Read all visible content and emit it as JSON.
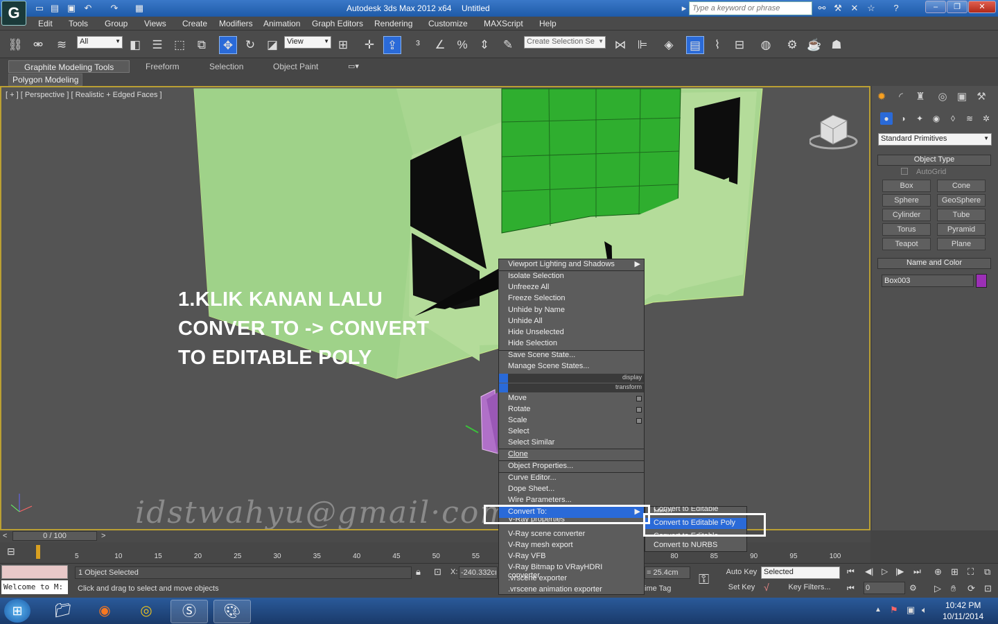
{
  "title": {
    "app": "Autodesk 3ds Max  2012 x64",
    "doc": "Untitled",
    "search_placeholder": "Type a keyword or phrase"
  },
  "menu": [
    "Edit",
    "Tools",
    "Group",
    "Views",
    "Create",
    "Modifiers",
    "Animation",
    "Graph Editors",
    "Rendering",
    "Customize",
    "MAXScript",
    "Help"
  ],
  "toolbar": {
    "filter_value": "All",
    "refcoord_value": "View",
    "selset_placeholder": "Create Selection Se"
  },
  "ribbon": {
    "tabs": [
      "Graphite Modeling Tools",
      "Freeform",
      "Selection",
      "Object Paint"
    ],
    "panel": "Polygon Modeling"
  },
  "viewport": {
    "label": "[ + ] [ Perspective ] [ Realistic + Edged Faces ]",
    "overlay": [
      "1.KLIK KANAN LALU",
      "CONVER TO -> CONVERT",
      "TO EDITABLE POLY"
    ],
    "watermark": "idstwahyu@gmail·com"
  },
  "context_menu": {
    "items": [
      "Viewport Lighting and Shadows",
      "Isolate Selection",
      "Unfreeze All",
      "Freeze Selection",
      "Unhide by Name",
      "Unhide All",
      "Hide Unselected",
      "Hide Selection",
      "Save Scene State...",
      "Manage Scene States..."
    ],
    "quad1": "display",
    "quad2": "transform",
    "items2": [
      "Move",
      "Rotate",
      "Scale",
      "Select",
      "Select Similar",
      "Clone",
      "Object Properties...",
      "Curve Editor...",
      "Dope Sheet...",
      "Wire Parameters...",
      "Convert To:",
      "V-Ray properties",
      "V-Ray scene converter",
      "V-Ray mesh export",
      "V-Ray VFB",
      "V-Ray Bitmap to VRayHDRI converter",
      ".vrscene exporter",
      ".vrscene animation exporter"
    ],
    "submenu": [
      "Convert to Editable Mesh",
      "Convert to Editable Poly",
      "Convert to Editable Patch",
      "Convert to NURBS"
    ]
  },
  "panel": {
    "dropdown": "Standard Primitives",
    "object_type": "Object Type",
    "autogrid": "AutoGrid",
    "primitives": [
      "Box",
      "Cone",
      "Sphere",
      "GeoSphere",
      "Cylinder",
      "Tube",
      "Torus",
      "Pyramid",
      "Teapot",
      "Plane"
    ],
    "name_color": "Name and Color",
    "object_name": "Box003",
    "object_color": "#9b2fb5"
  },
  "timeline": {
    "frame": "0 / 100",
    "ticks": [
      "5",
      "10",
      "15",
      "20",
      "25",
      "30",
      "35",
      "40",
      "45",
      "50",
      "55",
      "60",
      "65",
      "70",
      "75",
      "80",
      "85",
      "90",
      "95",
      "100"
    ]
  },
  "status": {
    "welcome": "Welcome to M:",
    "selected": "1 Object Selected",
    "prompt": "Click and drag to select and move objects",
    "x_label": "X:",
    "x_value": "-240.332cı",
    "z_value": "= 25.4cm",
    "time_tag": "ime Tag",
    "auto_key": "Auto Key",
    "set_key": "Set Key",
    "key_mode": "Selected",
    "key_filters": "Key Filters...",
    "frame_field": "0"
  },
  "taskbar": {
    "time": "10:42 PM",
    "date": "10/11/2014"
  }
}
